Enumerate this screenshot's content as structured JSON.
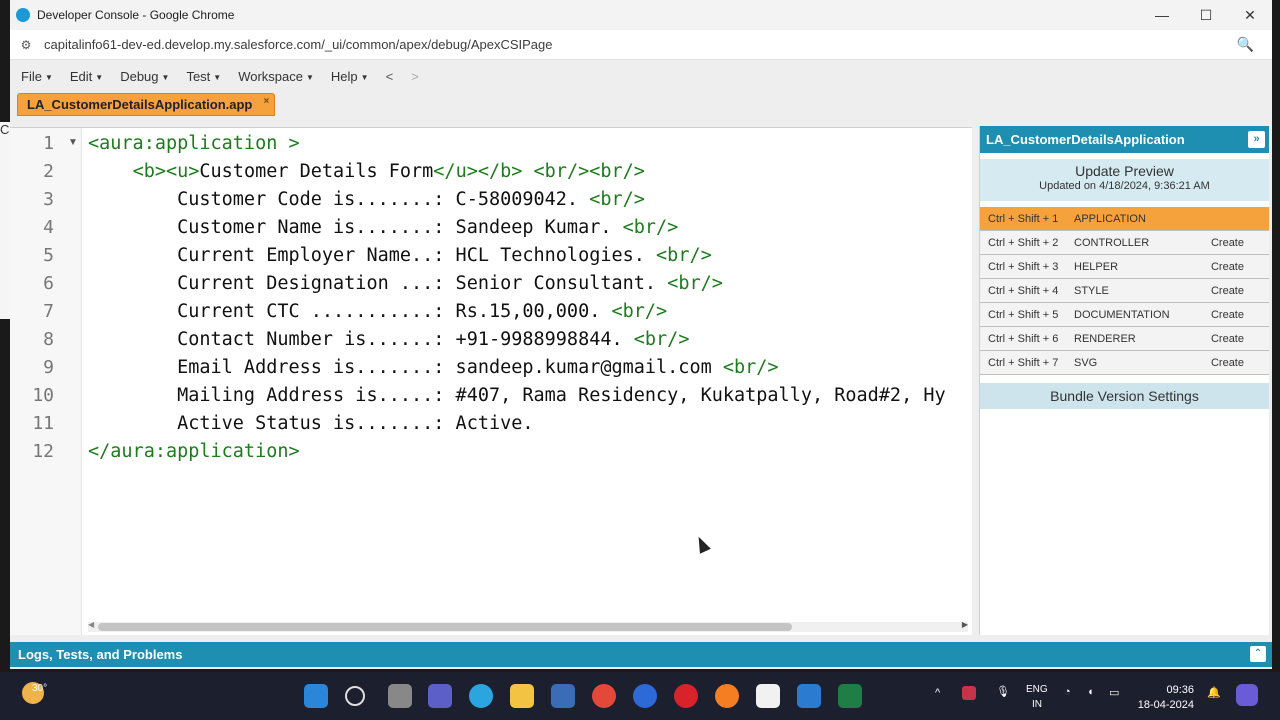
{
  "window": {
    "title": "Developer Console - Google Chrome",
    "controls": {
      "minimize": "—",
      "maximize": "☐",
      "close": "✕"
    }
  },
  "address_bar": {
    "url": "capitalinfo61-dev-ed.develop.my.salesforce.com/_ui/common/apex/debug/ApexCSIPage"
  },
  "menu": {
    "items": [
      "File",
      "Edit",
      "Debug",
      "Test",
      "Workspace",
      "Help"
    ],
    "back": "<",
    "forward": ">"
  },
  "editor_tab": {
    "label": "LA_CustomerDetailsApplication.app",
    "close": "×"
  },
  "left_strip_text": "CCCCCCEMA",
  "code": {
    "line_numbers": [
      "1",
      "2",
      "3",
      "4",
      "5",
      "6",
      "7",
      "8",
      "9",
      "10",
      "11",
      "12"
    ],
    "lines": [
      [
        {
          "t": "<aura:application >",
          "c": "tag"
        }
      ],
      [
        {
          "t": "    ",
          "c": ""
        },
        {
          "t": "<b><u>",
          "c": "tag"
        },
        {
          "t": "Customer Details Form",
          "c": ""
        },
        {
          "t": "</u></b> <br/><br/>",
          "c": "tag"
        }
      ],
      [
        {
          "t": "        Customer Code is.......: C-58009042. ",
          "c": ""
        },
        {
          "t": "<br/>",
          "c": "tag"
        }
      ],
      [
        {
          "t": "        Customer Name is.......: Sandeep Kumar. ",
          "c": ""
        },
        {
          "t": "<br/>",
          "c": "tag"
        }
      ],
      [
        {
          "t": "        Current Employer Name..: HCL Technologies. ",
          "c": ""
        },
        {
          "t": "<br/>",
          "c": "tag"
        }
      ],
      [
        {
          "t": "        Current Designation ...: Senior Consultant. ",
          "c": ""
        },
        {
          "t": "<br/>",
          "c": "tag"
        }
      ],
      [
        {
          "t": "        Current CTC ...........: Rs.15,00,000. ",
          "c": ""
        },
        {
          "t": "<br/>",
          "c": "tag"
        }
      ],
      [
        {
          "t": "        Contact Number is......: +91-9988998844. ",
          "c": ""
        },
        {
          "t": "<br/>",
          "c": "tag"
        }
      ],
      [
        {
          "t": "        Email Address is.......: sandeep.kumar@gmail.com ",
          "c": ""
        },
        {
          "t": "<br/>",
          "c": "tag"
        }
      ],
      [
        {
          "t": "        Mailing Address is.....: #407, Rama Residency, Kukatpally, Road#2, Hy",
          "c": ""
        }
      ],
      [
        {
          "t": "        Active Status is.......: Active.",
          "c": ""
        }
      ],
      [
        {
          "t": "</aura:application>",
          "c": "tag"
        }
      ]
    ]
  },
  "bundle_panel": {
    "title": "LA_CustomerDetailsApplication",
    "update_preview": "Update Preview",
    "updated_on": "Updated on 4/18/2024, 9:36:21 AM",
    "rows": [
      {
        "shortcut": "Ctrl + Shift + 1",
        "name": "APPLICATION",
        "action": "",
        "active": true
      },
      {
        "shortcut": "Ctrl + Shift + 2",
        "name": "CONTROLLER",
        "action": "Create",
        "active": false
      },
      {
        "shortcut": "Ctrl + Shift + 3",
        "name": "HELPER",
        "action": "Create",
        "active": false
      },
      {
        "shortcut": "Ctrl + Shift + 4",
        "name": "STYLE",
        "action": "Create",
        "active": false
      },
      {
        "shortcut": "Ctrl + Shift + 5",
        "name": "DOCUMENTATION",
        "action": "Create",
        "active": false
      },
      {
        "shortcut": "Ctrl + Shift + 6",
        "name": "RENDERER",
        "action": "Create",
        "active": false
      },
      {
        "shortcut": "Ctrl + Shift + 7",
        "name": "SVG",
        "action": "Create",
        "active": false
      }
    ],
    "bundle_version_settings": "Bundle Version Settings"
  },
  "logs_bar": {
    "label": "Logs, Tests, and Problems"
  },
  "taskbar": {
    "temperature": "30°",
    "apps": [
      "windows-start",
      "search",
      "task-view",
      "teams",
      "edge",
      "file-explorer",
      "mysql",
      "chrome",
      "zoom",
      "opera",
      "firefox",
      "g-app",
      "vscode",
      "excel"
    ],
    "language": "ENG",
    "region": "IN",
    "time": "09:36",
    "date": "18-04-2024"
  },
  "colors": {
    "accent_blue": "#1e8fb0",
    "tab_orange": "#f5a23c",
    "code_tag_green": "#1e7b1e"
  }
}
